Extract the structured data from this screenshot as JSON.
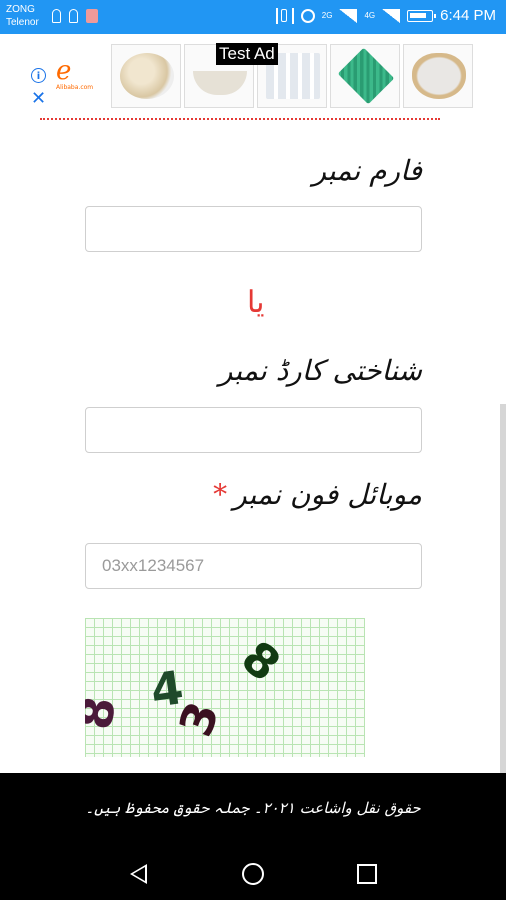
{
  "status_bar": {
    "carrier_1": "ZONG",
    "carrier_2": "Telenor",
    "network_1": "2G",
    "network_2": "4G",
    "time": "6:44 PM",
    "color": "#2196f3"
  },
  "ad": {
    "label": "Test Ad",
    "info_icon": "i",
    "close_icon": "✕",
    "brand_logo": "e",
    "brand_name": "Alibaba.com"
  },
  "form": {
    "form_number_label": "فارم نمبر",
    "form_number_value": "",
    "or_label": "یا",
    "cnic_label": "شناختی کارڈ نمبر",
    "cnic_value": "",
    "mobile_label": "موبائل فون نمبر",
    "mobile_required": "*",
    "mobile_placeholder": "03xx1234567",
    "captcha_digits": [
      "8",
      "4",
      "3",
      "8"
    ]
  },
  "footer": {
    "copyright": "حقوق نقل واشاعت ۲۰۲۱۔ جملہ حقوق محفوظ ہیں۔"
  },
  "colors": {
    "accent_red": "#e53935",
    "captcha_grid": "#b9e4b3"
  }
}
